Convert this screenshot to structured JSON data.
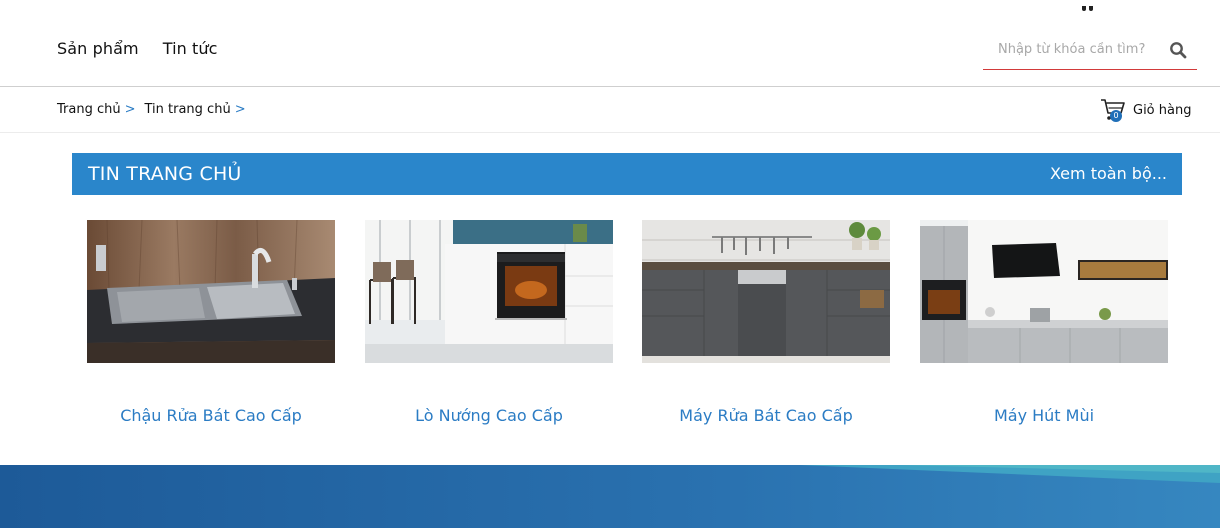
{
  "header": {
    "nav": [
      {
        "label": "Sản phẩm"
      },
      {
        "label": "Tin tức"
      }
    ],
    "search": {
      "placeholder": "Nhập từ khóa cần tìm?",
      "icon": "search-icon"
    }
  },
  "breadcrumb": {
    "items": [
      {
        "label": "Trang chủ"
      },
      {
        "label": "Tin trang chủ"
      }
    ],
    "separator": ">"
  },
  "cart": {
    "count": "0",
    "label": "Giỏ hàng",
    "icon": "cart-icon"
  },
  "section": {
    "title": "TIN TRANG CHỦ",
    "more_label": "Xem toàn bộ...",
    "color": "#2a86cb"
  },
  "articles": [
    {
      "title": "Chậu Rửa Bát Cao Cấp",
      "image": "sink-photo"
    },
    {
      "title": "Lò Nướng Cao Cấp",
      "image": "oven-photo"
    },
    {
      "title": "Máy Rửa Bát Cao Cấp",
      "image": "dishwasher-photo"
    },
    {
      "title": "Máy Hút Mùi",
      "image": "range-hood-photo"
    }
  ],
  "colors": {
    "accent": "#2b7cc4",
    "search_underline": "#d23a3a",
    "footer": "#1e5f9e"
  }
}
